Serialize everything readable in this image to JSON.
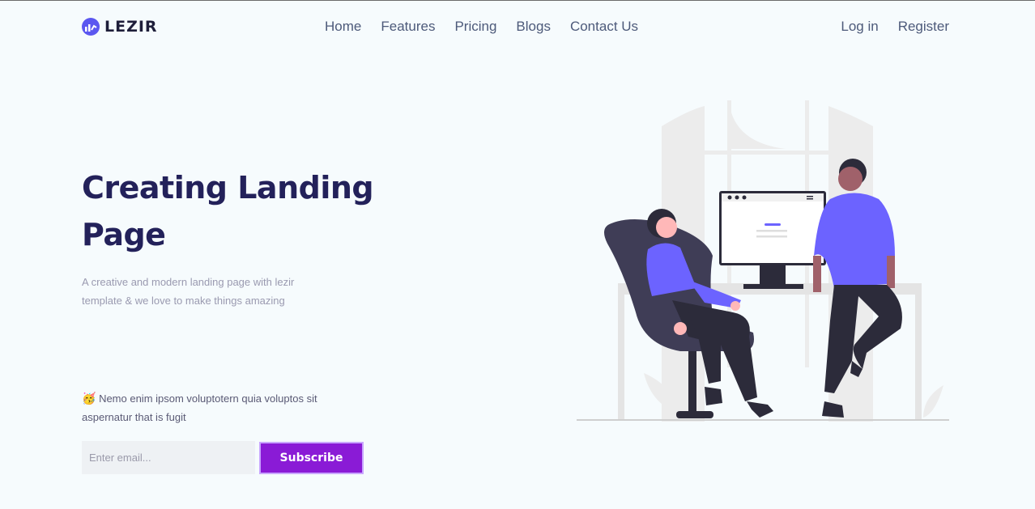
{
  "brand": {
    "name": "LEZIR",
    "accent": "#5b57f0"
  },
  "nav": {
    "links": [
      "Home",
      "Features",
      "Pricing",
      "Blogs",
      "Contact Us"
    ],
    "login": "Log in",
    "register": "Register"
  },
  "hero": {
    "title": "Creating Landing Page",
    "subtitle": "A creative and modern landing page with lezir template & we love to make things amazing",
    "note_emoji": "🥳",
    "note_text": "Nemo enim ipsom voluptotern quia voluptos sit aspernatur that is fugit",
    "email_placeholder": "Enter email...",
    "subscribe_label": "Subscribe",
    "subscribe_color": "#8a1bd6"
  },
  "illustration": {
    "icon": "office-scene-illustration"
  }
}
